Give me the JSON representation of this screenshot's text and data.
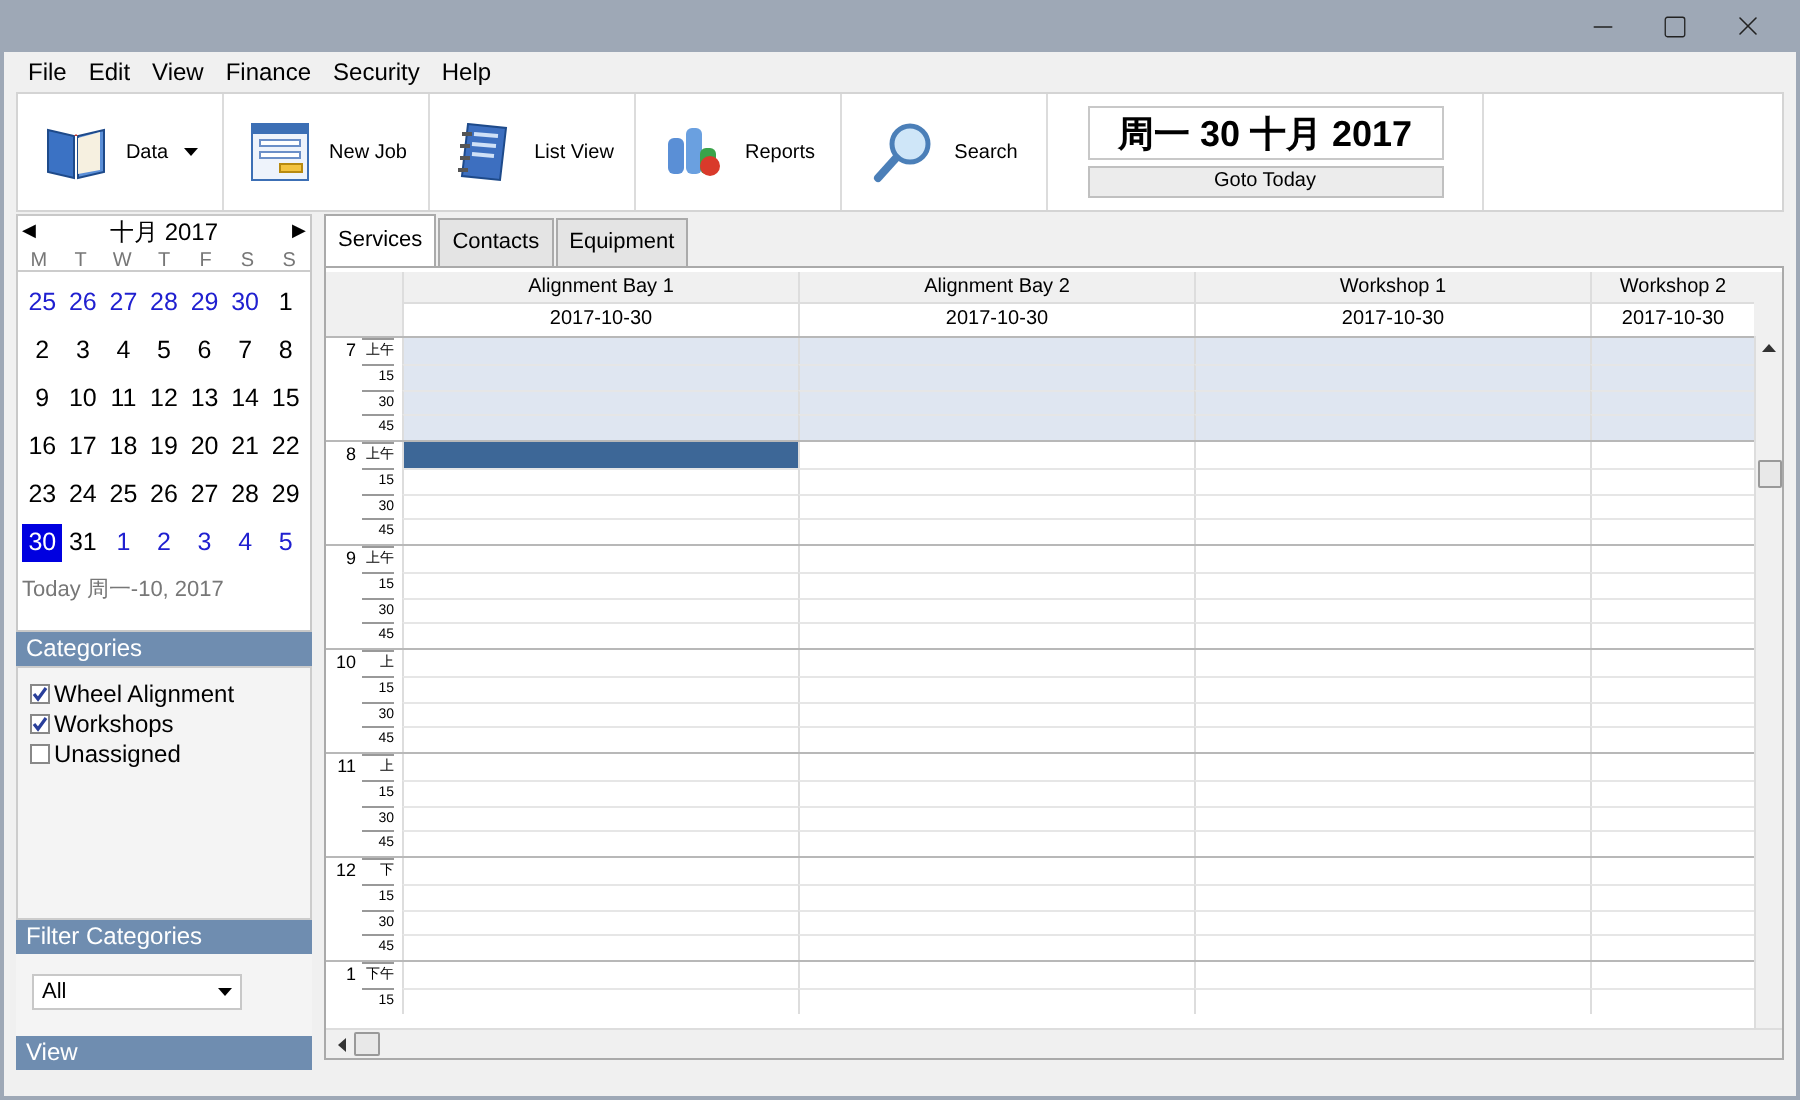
{
  "menu": [
    "File",
    "Edit",
    "View",
    "Finance",
    "Security",
    "Help"
  ],
  "toolbar": [
    {
      "label": "Data",
      "kind": "dropdown"
    },
    {
      "label": "New Job",
      "kind": "button"
    },
    {
      "label": "List View",
      "kind": "button"
    },
    {
      "label": "Reports",
      "kind": "button"
    },
    {
      "label": "Search",
      "kind": "button"
    }
  ],
  "date_display": {
    "text": "周一 30 十月 2017",
    "button": "Goto Today"
  },
  "calendar": {
    "prev": "◀",
    "next": "▶",
    "month": "十月 2017",
    "weekdays": [
      "M",
      "T",
      "W",
      "T",
      "F",
      "S",
      "S"
    ],
    "days": [
      {
        "label": "25",
        "other_month": true,
        "selected": false
      },
      {
        "label": "26",
        "other_month": true,
        "selected": false
      },
      {
        "label": "27",
        "other_month": true,
        "selected": false
      },
      {
        "label": "28",
        "other_month": true,
        "selected": false
      },
      {
        "label": "29",
        "other_month": true,
        "selected": false
      },
      {
        "label": "30",
        "other_month": true,
        "selected": false
      },
      {
        "label": "1",
        "other_month": false,
        "selected": false
      },
      {
        "label": "2",
        "other_month": false,
        "selected": false
      },
      {
        "label": "3",
        "other_month": false,
        "selected": false
      },
      {
        "label": "4",
        "other_month": false,
        "selected": false
      },
      {
        "label": "5",
        "other_month": false,
        "selected": false
      },
      {
        "label": "6",
        "other_month": false,
        "selected": false
      },
      {
        "label": "7",
        "other_month": false,
        "selected": false
      },
      {
        "label": "8",
        "other_month": false,
        "selected": false
      },
      {
        "label": "9",
        "other_month": false,
        "selected": false
      },
      {
        "label": "10",
        "other_month": false,
        "selected": false
      },
      {
        "label": "11",
        "other_month": false,
        "selected": false
      },
      {
        "label": "12",
        "other_month": false,
        "selected": false
      },
      {
        "label": "13",
        "other_month": false,
        "selected": false
      },
      {
        "label": "14",
        "other_month": false,
        "selected": false
      },
      {
        "label": "15",
        "other_month": false,
        "selected": false
      },
      {
        "label": "16",
        "other_month": false,
        "selected": false
      },
      {
        "label": "17",
        "other_month": false,
        "selected": false
      },
      {
        "label": "18",
        "other_month": false,
        "selected": false
      },
      {
        "label": "19",
        "other_month": false,
        "selected": false
      },
      {
        "label": "20",
        "other_month": false,
        "selected": false
      },
      {
        "label": "21",
        "other_month": false,
        "selected": false
      },
      {
        "label": "22",
        "other_month": false,
        "selected": false
      },
      {
        "label": "23",
        "other_month": false,
        "selected": false
      },
      {
        "label": "24",
        "other_month": false,
        "selected": false
      },
      {
        "label": "25",
        "other_month": false,
        "selected": false
      },
      {
        "label": "26",
        "other_month": false,
        "selected": false
      },
      {
        "label": "27",
        "other_month": false,
        "selected": false
      },
      {
        "label": "28",
        "other_month": false,
        "selected": false
      },
      {
        "label": "29",
        "other_month": false,
        "selected": false
      },
      {
        "label": "30",
        "other_month": false,
        "selected": true
      },
      {
        "label": "31",
        "other_month": false,
        "selected": false
      },
      {
        "label": "1",
        "other_month": true,
        "selected": false
      },
      {
        "label": "2",
        "other_month": true,
        "selected": false
      },
      {
        "label": "3",
        "other_month": true,
        "selected": false
      },
      {
        "label": "4",
        "other_month": true,
        "selected": false
      },
      {
        "label": "5",
        "other_month": true,
        "selected": false
      }
    ],
    "today": "Today 周一-10, 2017"
  },
  "categories": {
    "title": "Categories",
    "items": [
      {
        "label": "Wheel Alignment",
        "checked": true
      },
      {
        "label": "Workshops",
        "checked": true
      },
      {
        "label": "Unassigned",
        "checked": false
      }
    ]
  },
  "filter_categories": {
    "title": "Filter Categories",
    "value": "All"
  },
  "view": {
    "title": "View"
  },
  "tabs": [
    {
      "label": "Services",
      "selected": true
    },
    {
      "label": "Contacts",
      "selected": false
    },
    {
      "label": "Equipment",
      "selected": false
    }
  ],
  "schedule": {
    "columns": [
      {
        "name": "Alignment Bay 1",
        "date": "2017-10-30"
      },
      {
        "name": "Alignment Bay 2",
        "date": "2017-10-30"
      },
      {
        "name": "Workshop 1",
        "date": "2017-10-30"
      },
      {
        "name": "Workshop 2",
        "date": "2017-10-30"
      }
    ],
    "hours": [
      {
        "hour": "7",
        "shaded": true,
        "rows": [
          {
            "label": "上午",
            "selected": [
              false,
              false,
              false,
              false
            ]
          },
          {
            "label": "15",
            "selected": [
              false,
              false,
              false,
              false
            ]
          },
          {
            "label": "30",
            "selected": [
              false,
              false,
              false,
              false
            ]
          },
          {
            "label": "45",
            "selected": [
              false,
              false,
              false,
              false
            ]
          }
        ]
      },
      {
        "hour": "8",
        "shaded": false,
        "rows": [
          {
            "label": "上午",
            "selected": [
              true,
              false,
              false,
              false
            ]
          },
          {
            "label": "15",
            "selected": [
              false,
              false,
              false,
              false
            ]
          },
          {
            "label": "30",
            "selected": [
              false,
              false,
              false,
              false
            ]
          },
          {
            "label": "45",
            "selected": [
              false,
              false,
              false,
              false
            ]
          }
        ]
      },
      {
        "hour": "9",
        "shaded": false,
        "rows": [
          {
            "label": "上午",
            "selected": [
              false,
              false,
              false,
              false
            ]
          },
          {
            "label": "15",
            "selected": [
              false,
              false,
              false,
              false
            ]
          },
          {
            "label": "30",
            "selected": [
              false,
              false,
              false,
              false
            ]
          },
          {
            "label": "45",
            "selected": [
              false,
              false,
              false,
              false
            ]
          }
        ]
      },
      {
        "hour": "10",
        "shaded": false,
        "rows": [
          {
            "label": "上",
            "selected": [
              false,
              false,
              false,
              false
            ]
          },
          {
            "label": "15",
            "selected": [
              false,
              false,
              false,
              false
            ]
          },
          {
            "label": "30",
            "selected": [
              false,
              false,
              false,
              false
            ]
          },
          {
            "label": "45",
            "selected": [
              false,
              false,
              false,
              false
            ]
          }
        ]
      },
      {
        "hour": "11",
        "shaded": false,
        "rows": [
          {
            "label": "上",
            "selected": [
              false,
              false,
              false,
              false
            ]
          },
          {
            "label": "15",
            "selected": [
              false,
              false,
              false,
              false
            ]
          },
          {
            "label": "30",
            "selected": [
              false,
              false,
              false,
              false
            ]
          },
          {
            "label": "45",
            "selected": [
              false,
              false,
              false,
              false
            ]
          }
        ]
      },
      {
        "hour": "12",
        "shaded": false,
        "rows": [
          {
            "label": "下",
            "selected": [
              false,
              false,
              false,
              false
            ]
          },
          {
            "label": "15",
            "selected": [
              false,
              false,
              false,
              false
            ]
          },
          {
            "label": "30",
            "selected": [
              false,
              false,
              false,
              false
            ]
          },
          {
            "label": "45",
            "selected": [
              false,
              false,
              false,
              false
            ]
          }
        ]
      },
      {
        "hour": "1",
        "shaded": false,
        "rows": [
          {
            "label": "下午",
            "selected": [
              false,
              false,
              false,
              false
            ]
          },
          {
            "label": "15",
            "selected": [
              false,
              false,
              false,
              false
            ]
          }
        ]
      }
    ]
  }
}
